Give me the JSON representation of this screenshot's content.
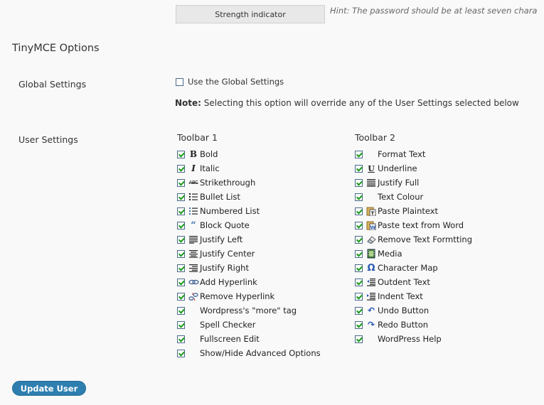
{
  "password": {
    "strength_label": "Strength indicator",
    "hint": "Hint: The password should be at least seven chara"
  },
  "section_title": "TinyMCE Options",
  "global_settings": {
    "label": "Global Settings",
    "checkbox_label": "Use the Global Settings",
    "checked": false,
    "note_bold": "Note:",
    "note_text": " Selecting this option will override any of the User Settings selected below"
  },
  "user_settings": {
    "label": "User Settings",
    "toolbar1": {
      "title": "Toolbar 1",
      "items": [
        {
          "label": "Bold",
          "icon": "bold-icon",
          "checked": true
        },
        {
          "label": "Italic",
          "icon": "italic-icon",
          "checked": true
        },
        {
          "label": "Strikethrough",
          "icon": "strikethrough-icon",
          "checked": true
        },
        {
          "label": "Bullet List",
          "icon": "bullet-list-icon",
          "checked": true
        },
        {
          "label": "Numbered List",
          "icon": "numbered-list-icon",
          "checked": true
        },
        {
          "label": "Block Quote",
          "icon": "blockquote-icon",
          "checked": true
        },
        {
          "label": "Justify Left",
          "icon": "justify-left-icon",
          "checked": true
        },
        {
          "label": "Justify Center",
          "icon": "justify-center-icon",
          "checked": true
        },
        {
          "label": "Justify Right",
          "icon": "justify-right-icon",
          "checked": true
        },
        {
          "label": "Add Hyperlink",
          "icon": "link-icon",
          "checked": true
        },
        {
          "label": "Remove Hyperlink",
          "icon": "unlink-icon",
          "checked": true
        },
        {
          "label": "Wordpress's \"more\" tag",
          "icon": "",
          "checked": true
        },
        {
          "label": "Spell Checker",
          "icon": "",
          "checked": true
        },
        {
          "label": "Fullscreen Edit",
          "icon": "",
          "checked": true
        },
        {
          "label": "Show/Hide Advanced Options",
          "icon": "",
          "checked": true
        }
      ]
    },
    "toolbar2": {
      "title": "Toolbar 2",
      "items": [
        {
          "label": "Format Text",
          "icon": "",
          "checked": true
        },
        {
          "label": "Underline",
          "icon": "underline-icon",
          "checked": true
        },
        {
          "label": "Justify Full",
          "icon": "justify-full-icon",
          "checked": true
        },
        {
          "label": "Text Colour",
          "icon": "",
          "checked": true
        },
        {
          "label": "Paste Plaintext",
          "icon": "paste-plaintext-icon",
          "checked": true
        },
        {
          "label": "Paste text from Word",
          "icon": "paste-word-icon",
          "checked": true
        },
        {
          "label": "Remove Text Formtting",
          "icon": "eraser-icon",
          "checked": true
        },
        {
          "label": "Media",
          "icon": "media-icon",
          "checked": true
        },
        {
          "label": "Character Map",
          "icon": "omega-icon",
          "checked": true
        },
        {
          "label": "Outdent Text",
          "icon": "outdent-icon",
          "checked": true
        },
        {
          "label": "Indent Text",
          "icon": "indent-icon",
          "checked": true
        },
        {
          "label": "Undo Button",
          "icon": "undo-icon",
          "checked": true
        },
        {
          "label": "Redo Button",
          "icon": "redo-icon",
          "checked": true
        },
        {
          "label": "WordPress Help",
          "icon": "",
          "checked": true
        }
      ]
    }
  },
  "update_button": "Update User",
  "colors": {
    "accent": "#2e7fb0",
    "check": "#1a9a1a",
    "background": "#f9f9f9"
  }
}
